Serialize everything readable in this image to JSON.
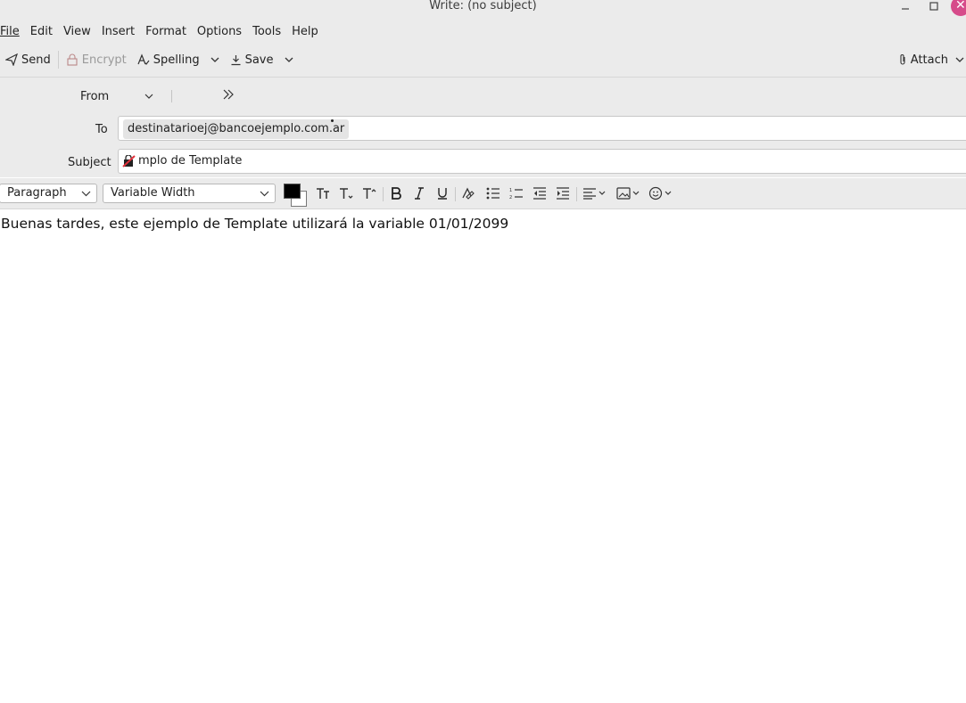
{
  "window": {
    "title": "Write: (no subject)"
  },
  "menubar": {
    "items": [
      "File",
      "Edit",
      "View",
      "Insert",
      "Format",
      "Options",
      "Tools",
      "Help"
    ]
  },
  "toolbar": {
    "send_label": "Send",
    "encrypt_label": "Encrypt",
    "spelling_label": "Spelling",
    "save_label": "Save",
    "attach_label": "Attach"
  },
  "headers": {
    "from_label": "From",
    "to_label": "To",
    "to_recipient": "destinatarioej@bancoejemplo.com.ar",
    "subject_label": "Subject",
    "subject_value": "mplo de Template"
  },
  "format": {
    "paragraph_value": "Paragraph",
    "font_value": "Variable Width",
    "text_color": "#000000",
    "bg_color": "#ffffff"
  },
  "body": {
    "text": "Buenas tardes, este ejemplo de Template utilizará la variable 01/01/2099"
  }
}
